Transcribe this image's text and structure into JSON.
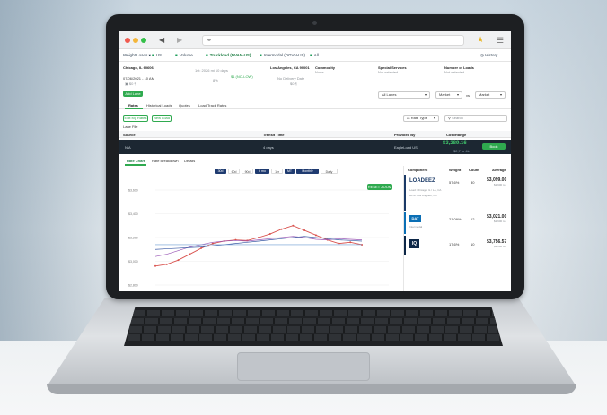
{
  "browser": {
    "url_icon": "lock-icon",
    "bookmark_icon": "star-icon",
    "menu_icon": "hamburger-icon"
  },
  "tabs": [
    {
      "label": "Weight Loads ▾"
    },
    {
      "label": "US"
    },
    {
      "label": "Volume"
    },
    {
      "label": "Truckload (DVAN-US)"
    },
    {
      "label": "Intermodal (DGVH-US)"
    },
    {
      "label": "All"
    }
  ],
  "history_label": "History",
  "route": {
    "origin": "Chicago, IL 60606",
    "destination": "Los Angeles, CA 90001",
    "date_label": "07/06/2021 - 10 AM",
    "lane_note": "1st: 2026 mi 10 days",
    "mid": "8%",
    "rate_badge": "$1 (NO-LOW)",
    "dest_note": "No Delivery Date",
    "dest_sub": "$0 ¶"
  },
  "commodity": {
    "title": "Commodity",
    "value": "None"
  },
  "special_services": {
    "title": "Special Services",
    "value": "Not selected"
  },
  "number_of_loads": {
    "title": "Number of Loads",
    "value": "Not selected"
  },
  "add_lane": "Add Lane",
  "filters": {
    "all_lanes": "All Lanes",
    "market1": "Market",
    "vs": "vs",
    "market2": "Market"
  },
  "subtabs": [
    "Rates",
    "Historical Loads",
    "Quotes",
    "Load Track Rates"
  ],
  "actions": {
    "edit_all": "Edit My Rates",
    "new_load": "New Load"
  },
  "rate_type": "Rate Type",
  "search_placeholder": "Search",
  "lane_file": "Lane File",
  "table_headers": {
    "source": "Source",
    "transit": "Transit Time",
    "provided": "Provided By",
    "cost": "Cost/Range"
  },
  "dark_row": {
    "source": "N/A",
    "transit": "4 days",
    "provided": "EagleLoad US",
    "price": "$3,289.16",
    "price_sub": "$2,7 to 4k",
    "book": "Book"
  },
  "chart_tabs": [
    "Rate Chart",
    "Rate Breakdown",
    "Details"
  ],
  "range_buttons": [
    "30d",
    "60d",
    "90d",
    "6 mo",
    "1yr",
    "MT",
    "Monthly",
    "Daily"
  ],
  "chart_badge": "RESET ZOOM",
  "chart_data": {
    "type": "line",
    "y_ticks": [
      "$3,600",
      "$3,400",
      "$3,200",
      "$3,000",
      "$2,800"
    ],
    "ylim": [
      2800,
      3600
    ],
    "series": [
      {
        "color": "#d9534f",
        "values": [
          2960,
          2975,
          3010,
          3060,
          3110,
          3150,
          3170,
          3180,
          3175,
          3200,
          3230,
          3270,
          3300,
          3260,
          3220,
          3180,
          3150,
          3160,
          3140
        ]
      },
      {
        "color": "#9b59b6",
        "values": [
          3040,
          3060,
          3090,
          3120,
          3140,
          3160,
          3170,
          3175,
          3170,
          3180,
          3190,
          3200,
          3210,
          3200,
          3185,
          3180,
          3190,
          3185,
          3180
        ]
      },
      {
        "color": "#3b5ba5",
        "values": [
          3100,
          3105,
          3110,
          3115,
          3120,
          3130,
          3140,
          3150,
          3160,
          3170,
          3180,
          3190,
          3200,
          3210,
          3200,
          3190,
          3180,
          3175,
          3170
        ]
      },
      {
        "color": "#6c9bd2",
        "values": [
          3140,
          3140,
          3140,
          3140,
          3140,
          3140,
          3140,
          3140,
          3140,
          3140,
          3140,
          3140,
          3140,
          3140,
          3140,
          3140,
          3140,
          3140,
          3140
        ]
      }
    ]
  },
  "providers": {
    "headers": [
      "Component",
      "Weight",
      "Count",
      "Average"
    ],
    "rows": [
      {
        "logo": "LOADEEZ",
        "weight": "57.6%",
        "count": "30",
        "avg": "$3,099.00",
        "avg_sub": "$2,900 to",
        "note1": "Load: Chicago, IL / LA, CA",
        "note2": "RPM: Los Angeles, CA"
      },
      {
        "logo": "DAT",
        "weight": "21.09%",
        "count": "12",
        "avg": "$3,021.00",
        "avg_sub": "$2,900 to",
        "note1": "Intermodal"
      },
      {
        "logo": "IQ",
        "weight": "17.6%",
        "count": "10",
        "avg": "$3,756.57",
        "avg_sub": "$3,100 to"
      }
    ]
  },
  "colors": {
    "brand_green": "#2faa4f",
    "dark_bar": "#1c2732",
    "lid": "#1d1f22"
  }
}
